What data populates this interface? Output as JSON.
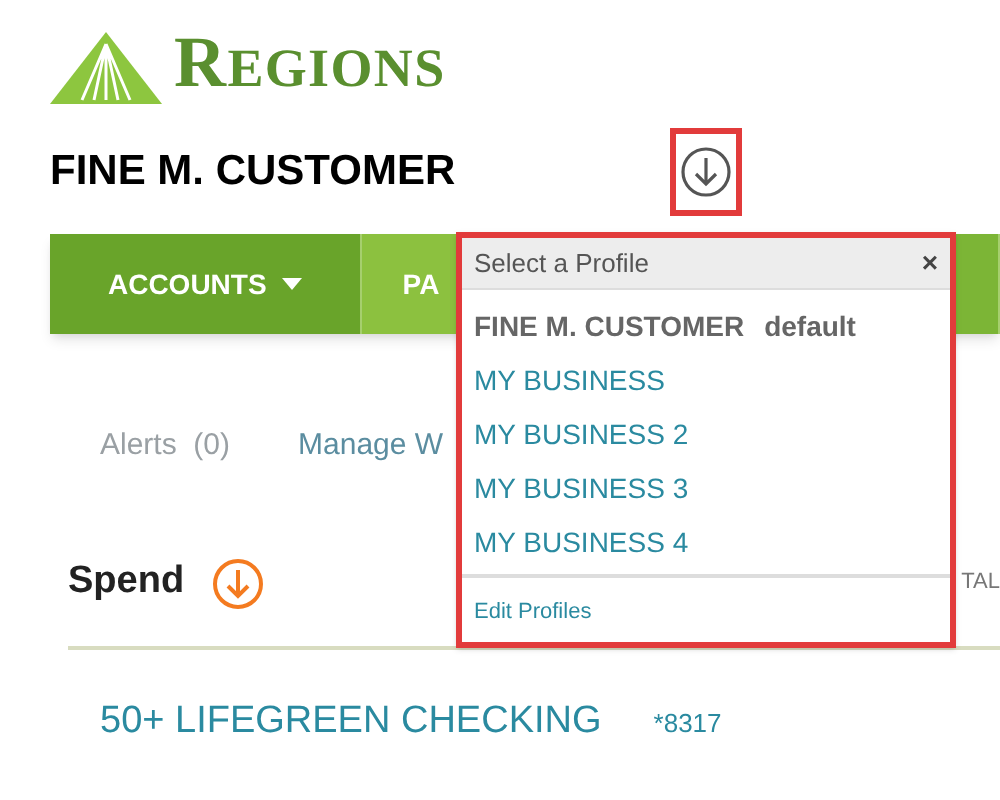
{
  "brand": {
    "name": "REGIONS"
  },
  "customer_name": "FINE M. CUSTOMER",
  "nav": {
    "tabs": [
      {
        "label": "ACCOUNTS",
        "selected": true
      },
      {
        "label": "PA",
        "selected": false
      },
      {
        "selected": false
      }
    ]
  },
  "links": [
    {
      "label": "Alerts  (0)",
      "kind": "muted"
    },
    {
      "label": "Manage W",
      "kind": "link"
    }
  ],
  "spend": {
    "title": "Spend",
    "column_label": "TAL"
  },
  "account": {
    "name": "50+ LIFEGREEN CHECKING",
    "number": "*8317"
  },
  "profile_popup": {
    "title": "Select a Profile",
    "close": "×",
    "profiles": [
      {
        "name": "FINE M. CUSTOMER",
        "badge": "default",
        "selected": true
      },
      {
        "name": "MY BUSINESS",
        "selected": false
      },
      {
        "name": "MY BUSINESS 2",
        "selected": false
      },
      {
        "name": "MY BUSINESS 3",
        "selected": false
      },
      {
        "name": "MY BUSINESS 4",
        "selected": false
      }
    ],
    "footer_link": "Edit Profiles"
  }
}
